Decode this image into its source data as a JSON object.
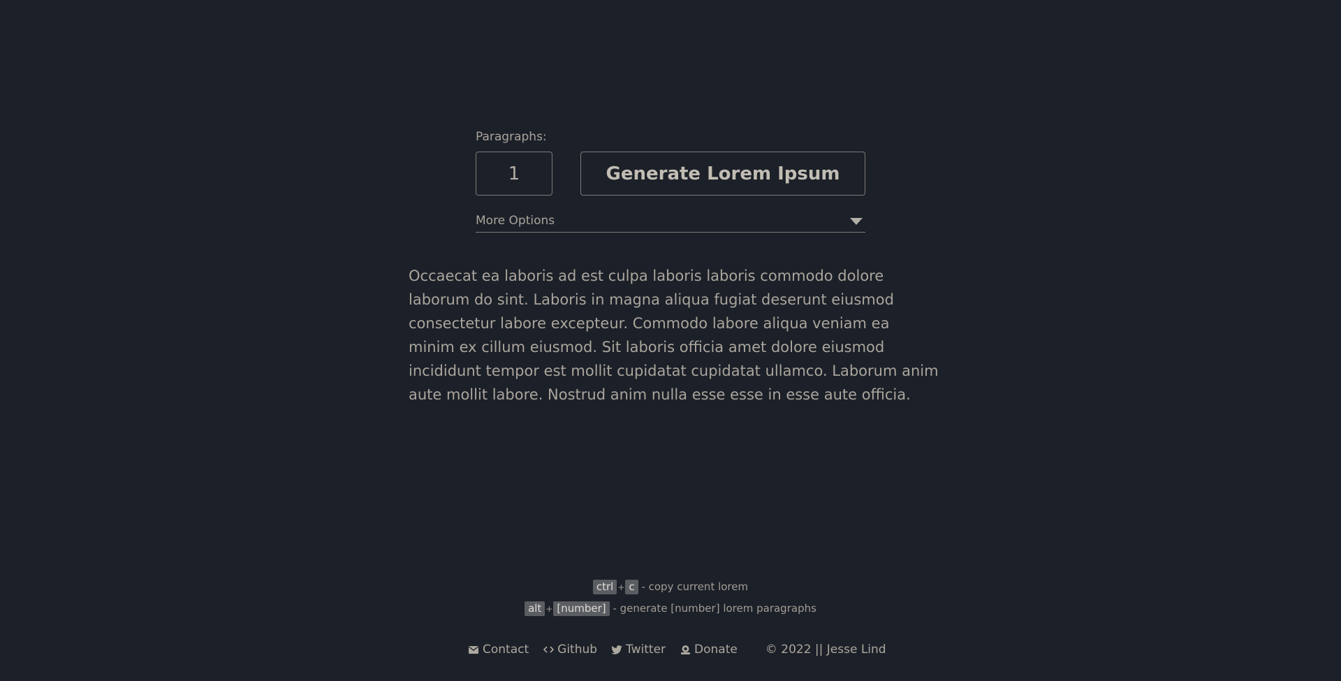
{
  "controls": {
    "paragraphs_label": "Paragraphs:",
    "paragraphs_value": "1",
    "generate_label": "Generate Lorem Ipsum",
    "more_options_label": "More Options"
  },
  "lorem": {
    "text": "Occaecat ea laboris ad est culpa laboris laboris commodo dolore laborum do sint. Laboris in magna aliqua fugiat deserunt eiusmod consectetur labore excepteur. Commodo labore aliqua veniam ea minim ex cillum eiusmod. Sit laboris officia amet dolore eiusmod incididunt tempor est mollit cupidatat cupidatat ullamco. Laborum anim aute mollit labore. Nostrud anim nulla esse esse in esse aute officia."
  },
  "shortcuts": {
    "copy": {
      "key1": "ctrl",
      "plus": "+",
      "key2": "c",
      "desc": "- copy current lorem"
    },
    "generate": {
      "key1": "alt",
      "plus": "+",
      "key2": "[number]",
      "desc": "- generate [number] lorem paragraphs"
    }
  },
  "footer": {
    "contact": "Contact",
    "github": "Github",
    "twitter": "Twitter",
    "donate": "Donate",
    "copyright": "© 2022 || Jesse Lind"
  },
  "icons": {
    "contact": "envelope-icon",
    "github": "code-icon",
    "twitter": "twitter-bird-icon",
    "donate": "donate-icon",
    "more_options": "caret-down-icon"
  },
  "colors": {
    "background": "#1c2028",
    "text": "#b3aea6",
    "border": "#7c7b78",
    "kbd_background": "#5a5e63"
  }
}
